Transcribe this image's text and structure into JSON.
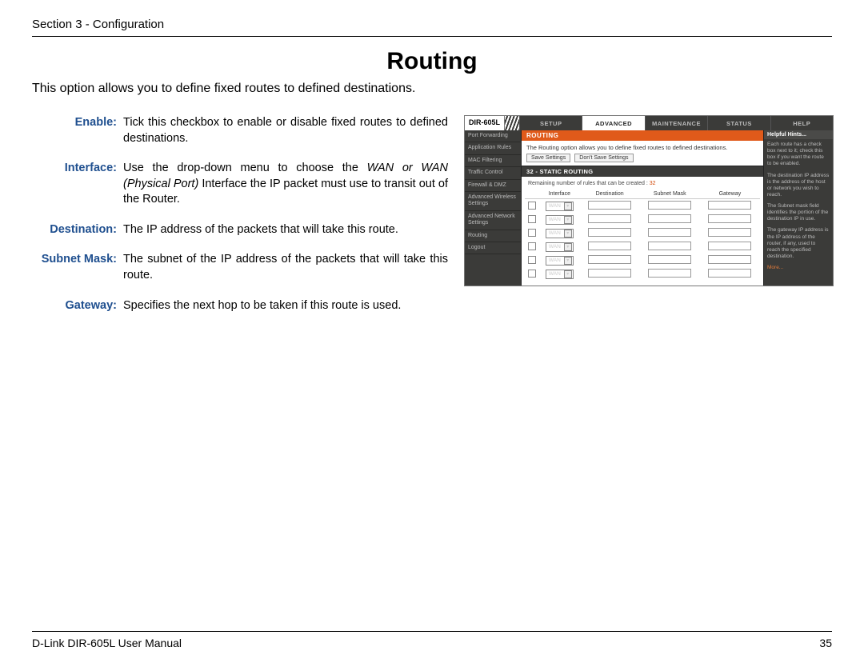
{
  "header": {
    "section": "Section 3 - Configuration"
  },
  "title": "Routing",
  "intro": "This option allows you to define fixed routes to defined destinations.",
  "definitions": [
    {
      "label": "Enable:",
      "body": "Tick this checkbox to enable or disable fixed routes to defined destinations."
    },
    {
      "label": "Interface:",
      "body_pre": "Use the drop-down menu to choose the ",
      "body_em": "WAN or WAN (Physical Port)",
      "body_post": " Interface the IP packet must use to transit out of the Router."
    },
    {
      "label": "Destination:",
      "body": "The IP address of the packets that will take this route."
    },
    {
      "label": "Subnet Mask:",
      "body": "The subnet of the IP address of the packets that will take this route."
    },
    {
      "label": "Gateway:",
      "body": "Specifies the next hop to be taken if this route is used."
    }
  ],
  "router": {
    "model": "DIR-605L",
    "tabs": [
      "SETUP",
      "ADVANCED",
      "MAINTENANCE",
      "STATUS",
      "HELP"
    ],
    "active_tab": "ADVANCED",
    "sidebar": [
      "Port Forwarding",
      "Application Rules",
      "MAC Filtering",
      "Traffic Control",
      "Firewall & DMZ",
      "Advanced Wireless Settings",
      "Advanced Network Settings",
      "Routing",
      "Logout"
    ],
    "banner": "ROUTING",
    "panel_desc": "The Routing option allows you to define fixed routes to defined destinations.",
    "buttons": {
      "save": "Save Settings",
      "dont": "Don't Save Settings"
    },
    "subbanner": "32 - STATIC ROUTING",
    "remain_text": "Remaining number of rules that can be created : ",
    "remain_num": "32",
    "columns": [
      "Interface",
      "Destination",
      "Subnet Mask",
      "Gateway"
    ],
    "row_select": "WAN",
    "row_count": 6,
    "hints_title": "Helpful Hints...",
    "hints": [
      "Each route has a check box next to it; check this box if you want the route to be enabled.",
      "The destination IP address is the address of the host or network you wish to reach.",
      "The Subnet mask field identifies the portion of the destination IP in use.",
      "The gateway IP address is the IP address of the router, if any, used to reach the specified destination."
    ],
    "hints_more": "More..."
  },
  "footer": {
    "left": "D-Link DIR-605L User Manual",
    "right": "35"
  }
}
